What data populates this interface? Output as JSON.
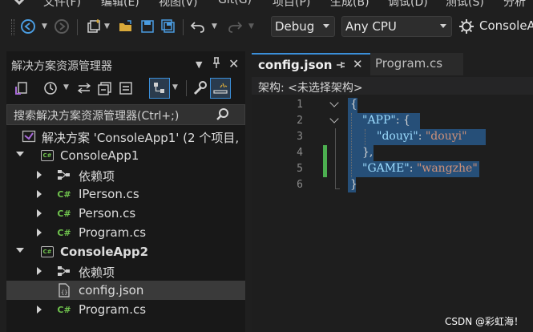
{
  "menu": {
    "items": [
      "文件(F)",
      "编辑(E)",
      "视图(V)",
      "Git(G)",
      "项目(P)",
      "生成(B)",
      "调试(D)",
      "测试(S)",
      "分析"
    ]
  },
  "toolbar": {
    "configuration": "Debug",
    "platform": "Any CPU",
    "startup_project": "ConsoleApp"
  },
  "solution_explorer": {
    "title": "解决方案资源管理器",
    "search_placeholder": "搜索解决方案资源管理器(Ctrl+;)",
    "tree": [
      {
        "label": "解决方案 'ConsoleApp1' (2 个项目,",
        "icon": "solution-icon",
        "level": 0
      },
      {
        "label": "ConsoleApp1",
        "icon": "csharp-project-icon",
        "level": 1,
        "expanded": true
      },
      {
        "label": "依赖项",
        "icon": "dependencies-icon",
        "level": 2,
        "expanded": false
      },
      {
        "label": "IPerson.cs",
        "icon": "csharp-file-icon",
        "level": 2,
        "expanded": false
      },
      {
        "label": "Person.cs",
        "icon": "csharp-file-icon",
        "level": 2,
        "expanded": false
      },
      {
        "label": "Program.cs",
        "icon": "csharp-file-icon",
        "level": 2,
        "expanded": false
      },
      {
        "label": "ConsoleApp2",
        "icon": "csharp-project-icon",
        "level": 1,
        "expanded": true,
        "bold": true
      },
      {
        "label": "依赖项",
        "icon": "dependencies-icon",
        "level": 2,
        "expanded": false
      },
      {
        "label": "config.json",
        "icon": "json-file-icon",
        "level": 2,
        "selected": true
      },
      {
        "label": "Program.cs",
        "icon": "csharp-file-icon",
        "level": 2,
        "expanded": false
      }
    ]
  },
  "editor": {
    "tabs": [
      {
        "label": "config.json",
        "active": true
      },
      {
        "label": "Program.cs",
        "active": false
      }
    ],
    "nav": {
      "label": "架构:",
      "value": "<未选择架构>"
    },
    "line_numbers": [
      "1",
      "2",
      "3",
      "4",
      "5",
      "6"
    ],
    "code": {
      "l1": "{",
      "l2_key": "\"APP\"",
      "l2_rest": ": {",
      "l3_key": "\"douyi\"",
      "l3_colon": ": ",
      "l3_val": "\"douyi\"",
      "l4": "},",
      "l5_key": "\"GAME\"",
      "l5_colon": ": ",
      "l5_val": "\"wangzhe\"",
      "l6": "}"
    },
    "colors": {
      "key": "#9cdcfe",
      "string": "#ce9178",
      "punct": "#d4d4d4",
      "selection": "#264f78",
      "modified": "#4caf50"
    }
  },
  "watermark": "CSDN @彩虹海！"
}
